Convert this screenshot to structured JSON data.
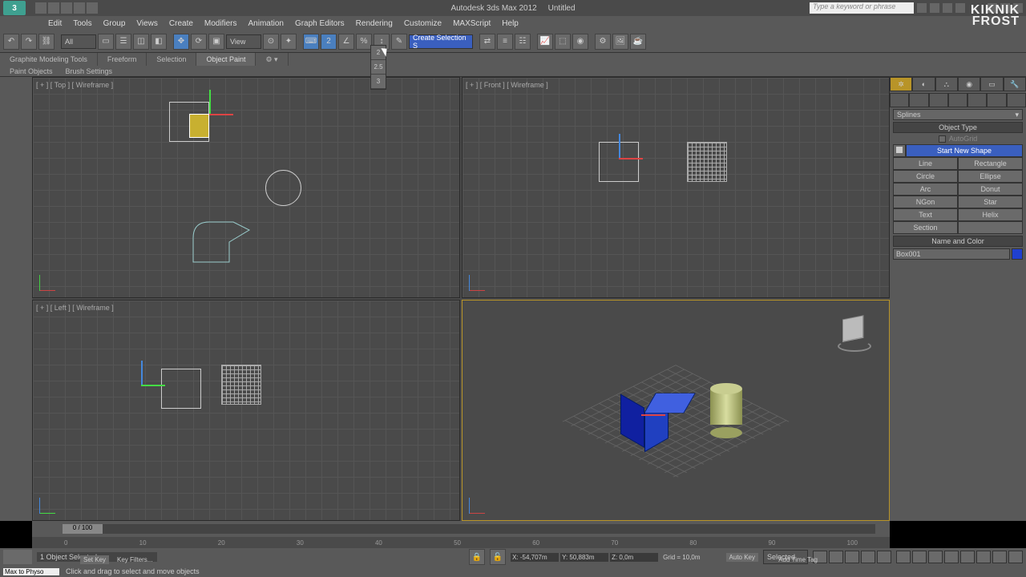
{
  "app": {
    "title": "Autodesk 3ds Max 2012",
    "doc": "Untitled",
    "search_placeholder": "Type a keyword or phrase"
  },
  "watermark": {
    "line1": "KIKNIK",
    "line2": "FROST"
  },
  "menu": [
    "Edit",
    "Tools",
    "Group",
    "Views",
    "Create",
    "Modifiers",
    "Animation",
    "Graph Editors",
    "Rendering",
    "Customize",
    "MAXScript",
    "Help"
  ],
  "toolbar": {
    "filter": "All",
    "refcoord": "View",
    "named_sel": "Create Selection S"
  },
  "ribbon": {
    "tabs": [
      "Graphite Modeling Tools",
      "Freeform",
      "Selection",
      "Object Paint"
    ],
    "active": 3,
    "sub": [
      "Paint Objects",
      "Brush Settings"
    ]
  },
  "snap_menu": [
    "2",
    "2.5",
    "3"
  ],
  "viewports": {
    "tl": "[ + ] [ Top ] [ Wireframe ]",
    "tr": "[ + ] [ Front ] [ Wireframe ]",
    "bl": "[ + ] [ Left ] [ Wireframe ]",
    "br": ""
  },
  "panel": {
    "category": "Splines",
    "rollout_objtype": "Object Type",
    "autogrid": "AutoGrid",
    "start_new": "Start New Shape",
    "buttons": [
      [
        "Line",
        "Rectangle"
      ],
      [
        "Circle",
        "Ellipse"
      ],
      [
        "Arc",
        "Donut"
      ],
      [
        "NGon",
        "Star"
      ],
      [
        "Text",
        "Helix"
      ],
      [
        "Section",
        ""
      ]
    ],
    "rollout_name": "Name and Color",
    "obj_name": "Box001"
  },
  "time": {
    "handle": "0 / 100",
    "ticks": [
      "0",
      "10",
      "20",
      "30",
      "40",
      "50",
      "60",
      "70",
      "80",
      "90",
      "100"
    ]
  },
  "status": {
    "selected": "1 Object Selected",
    "x": "-54,707m",
    "y": "50,883m",
    "z": "0,0m",
    "grid": "Grid = 10,0m",
    "autokey": "Auto Key",
    "setkey": "Set Key",
    "keyfilters": "Key Filters...",
    "selected_mode": "Selected",
    "addtag": "Add Time Tag"
  },
  "prompt": {
    "script": "Max to Physo",
    "msg": "Click and drag to select and move objects"
  }
}
